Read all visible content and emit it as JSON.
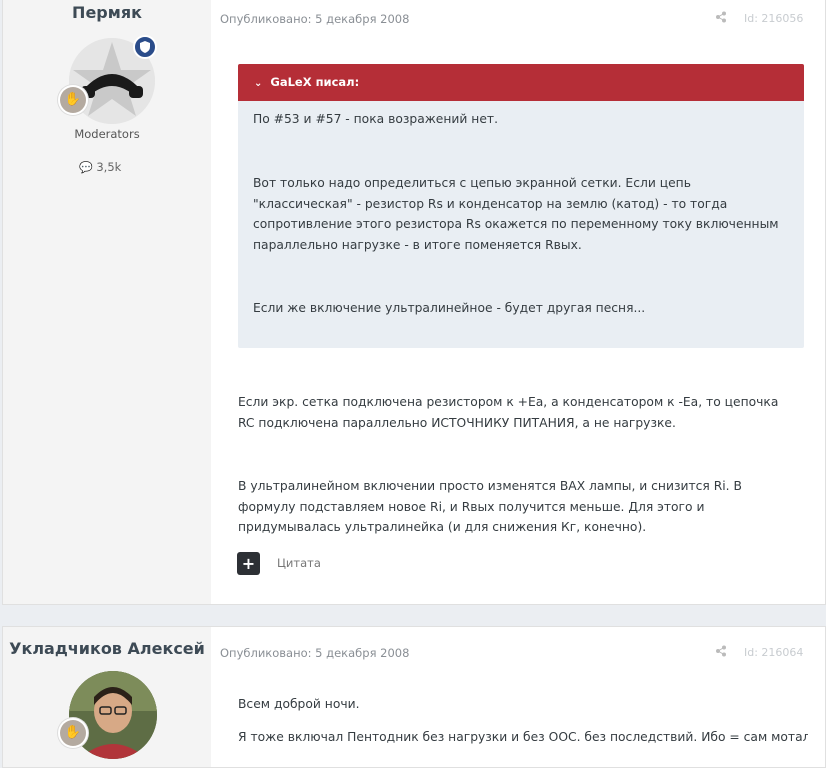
{
  "post1": {
    "author": "Пермяк",
    "role": "Moderators",
    "posts_count": "3,5k",
    "date": "Опубликовано: 5 декабря 2008",
    "post_id": "Id: 216056",
    "quote": {
      "header": "GaLeX писал:",
      "paragraphs": [
        "По #53 и #57 - пока возражений нет.",
        "Вот только надо определиться с цепью экранной сетки. Если цепь \"классическая\" - резистор Rs и конденсатор на землю (катод) - то тогда сопротивление этого резистора Rs окажется по переменному току включенным параллельно нагрузке - в итоге поменяется Rвых.",
        "Если же включение ультралинейное - будет другая песня..."
      ]
    },
    "paragraphs": [
      "Если экр. сетка подключена резистором к +Еа, а конденсатором к -Еа, то цепочка RC подключена параллельно ИСТОЧНИКУ ПИТАНИЯ, а не нагрузке.",
      "В ультралинейном включении просто изменятся ВАХ лампы, и снизится Ri. В формулу подставляем новое Ri, и Rвых получится меньше. Для этого и придумывалась ультралинейка (и для снижения Кг, конечно)."
    ],
    "quote_button": "Цитата"
  },
  "post2": {
    "author": "Укладчиков Алексей",
    "date": "Опубликовано: 5 декабря 2008",
    "post_id": "Id: 216064",
    "paragraphs": [
      "Всем доброй ночи.",
      "Я тоже включал Пентодник без нагрузки и без ООС. без последствий. Ибо = сам мотал, для"
    ]
  },
  "colors": {
    "quote_header": "#b52e37",
    "quote_bg": "#e9eef3",
    "badge": "#2a4c8a"
  },
  "icons": [
    "share-icon",
    "comment-icon",
    "chevron-down-icon",
    "plus-icon",
    "shield-icon",
    "hand-icon"
  ]
}
